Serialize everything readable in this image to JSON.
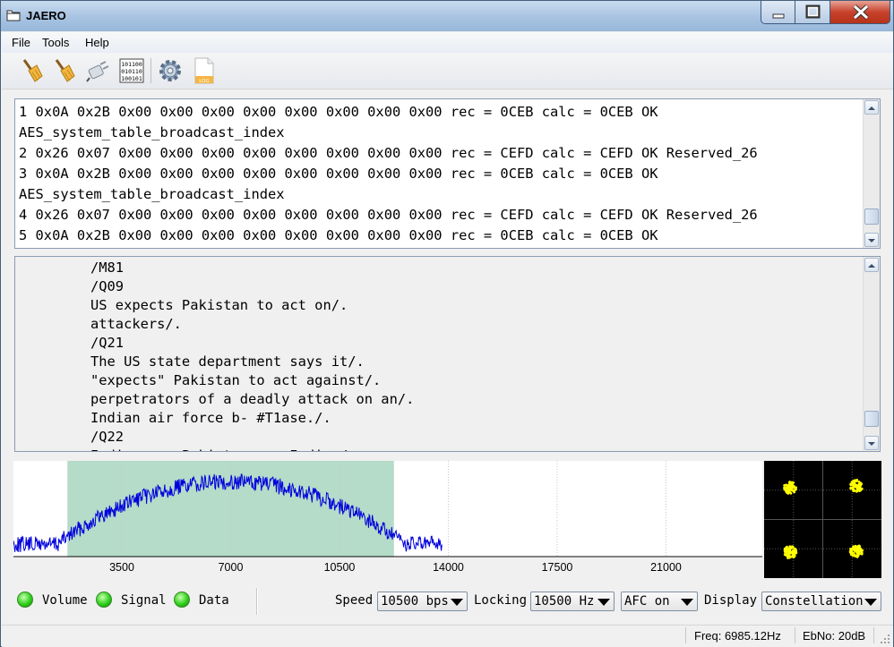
{
  "window": {
    "title": "JAERO"
  },
  "menu": {
    "items": [
      {
        "id": "file",
        "label": "File"
      },
      {
        "id": "tools",
        "label": "Tools"
      },
      {
        "id": "help",
        "label": "Help"
      }
    ]
  },
  "toolbar": {
    "icons": [
      "broom-icon",
      "broom-icon",
      "plug-icon",
      "binary-icon",
      "gear-icon",
      "log-file-icon"
    ]
  },
  "top_output": {
    "lines": [
      "1 0x0A 0x2B 0x00 0x00 0x00 0x00 0x00 0x00 0x00 0x00 rec = 0CEB calc = 0CEB OK",
      "AES_system_table_broadcast_index",
      "2 0x26 0x07 0x00 0x00 0x00 0x00 0x00 0x00 0x00 0x00 rec = CEFD calc = CEFD OK Reserved_26",
      "3 0x0A 0x2B 0x00 0x00 0x00 0x00 0x00 0x00 0x00 0x00 rec = 0CEB calc = 0CEB OK",
      "AES_system_table_broadcast_index",
      "4 0x26 0x07 0x00 0x00 0x00 0x00 0x00 0x00 0x00 0x00 rec = CEFD calc = CEFD OK Reserved_26",
      "5 0x0A 0x2B 0x00 0x00 0x00 0x00 0x00 0x00 0x00 0x00 rec = 0CEB calc = 0CEB OK"
    ]
  },
  "message_output": {
    "lines": [
      "/M81",
      "/Q09",
      "US expects Pakistan to act on/.",
      "attackers/.",
      "/Q21",
      "The US state department says it/.",
      "\"expects\" Pakistan to act against/.",
      "perpetrators of a deadly attack on an/.",
      "Indian air force b- #T1ase./.",
      "/Q22",
      "Indian ... Pakistan ... Indian/."
    ]
  },
  "spectrum": {
    "x_ticks": [
      "3500",
      "7000",
      "10500",
      "14000",
      "17500",
      "21000"
    ],
    "colors": {
      "signal": "#0000dd",
      "passband": "#b4dcc8",
      "grid": "#c8c8c8"
    },
    "passband_hz": [
      1750,
      12250
    ],
    "signal_extent_hz": [
      0,
      13800
    ]
  },
  "constellation": {
    "point_color": "#ffff00",
    "grid_color": "#555555"
  },
  "indicators": [
    {
      "id": "volume",
      "label": "Volume",
      "color": "#2ed01a"
    },
    {
      "id": "signal",
      "label": "Signal",
      "color": "#2ed01a"
    },
    {
      "id": "data",
      "label": "Data",
      "color": "#2ed01a"
    }
  ],
  "controls": {
    "speed_label": "Speed",
    "speed_value": "10500 bps",
    "locking_label": "Locking",
    "locking_value": "10500 Hz",
    "afc_value": "AFC on",
    "display_label": "Display",
    "display_value": "Constellation"
  },
  "status": {
    "freq": "Freq: 6985.12Hz",
    "ebno": "EbNo: 20dB"
  }
}
